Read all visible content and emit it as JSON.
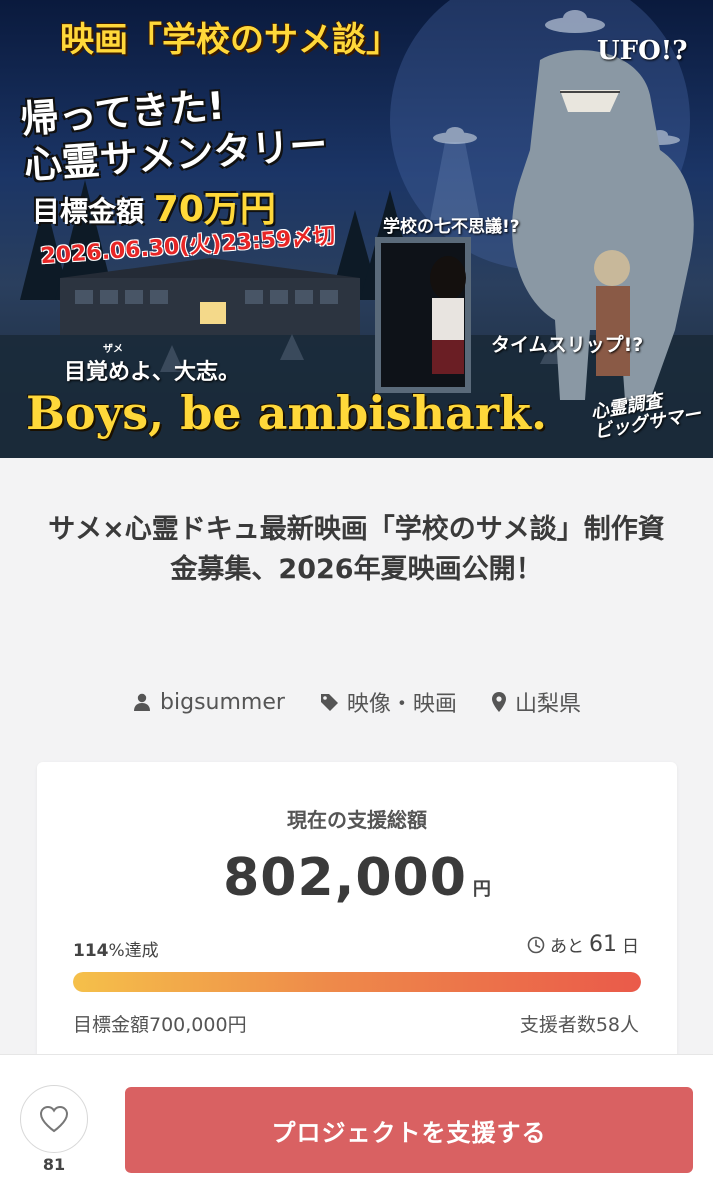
{
  "hero": {
    "movie_title": "映画「学校のサメ談」",
    "ufo": "UFO!?",
    "slogan_line1": "帰ってきた!",
    "slogan_line2": "心霊サメンタリー",
    "goal_prefix": "目標金額",
    "goal_amount": "70万円",
    "deadline": "2026.06.30(火)23:59〆切",
    "seven_wonders": "学校の七不思議!?",
    "time_slip": "タイムスリップ!?",
    "ruby": "ザメ",
    "awaken": "目覚めよ、大志。",
    "boys": "Boys, be ambishark.",
    "logo_line1": "心霊調査",
    "logo_line2": "ビッグサマー"
  },
  "project": {
    "title": "サメ×心霊ドキュ最新映画「学校のサメ談」制作資金募集、2026年夏映画公開！",
    "owner": "bigsummer",
    "category": "映像・映画",
    "location": "山梨県"
  },
  "icons": {
    "owner": "user-icon",
    "category": "tag-icon",
    "location": "location-pin-icon",
    "clock": "clock-icon",
    "like": "heart-icon"
  },
  "funding": {
    "label": "現在の支援総額",
    "amount": "802,000",
    "currency": "円",
    "percent_num": "114",
    "percent_suffix": "%達成",
    "remaining_prefix": "あと",
    "remaining_days": "61",
    "remaining_unit": "日",
    "progress": 1.0,
    "target": "目標金額700,000円",
    "backers": "支援者数58人"
  },
  "actions": {
    "like_count": "81",
    "support_button": "プロジェクトを支援する"
  },
  "colors": {
    "accent_button": "#d96162",
    "progress_start": "#f5c04a",
    "progress_end": "#ea5a4a",
    "hero_yellow": "#ffd83a",
    "deadline_red": "#e82626"
  }
}
